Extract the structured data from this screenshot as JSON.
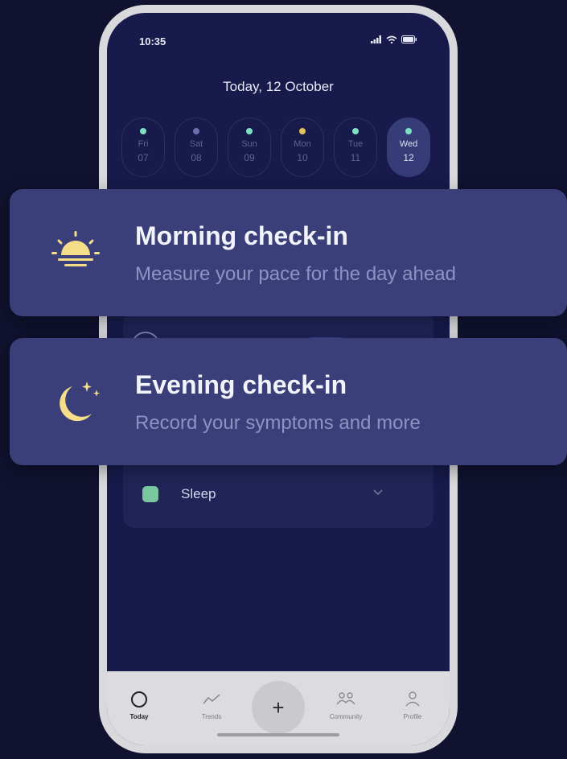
{
  "status_bar": {
    "time": "10:35"
  },
  "header": {
    "date_title": "Today, 12 October"
  },
  "days": [
    {
      "name": "Fri",
      "num": "07",
      "dot_color": "#7ee0c0",
      "active": false
    },
    {
      "name": "Sat",
      "num": "08",
      "dot_color": "#6b6fae",
      "active": false
    },
    {
      "name": "Sun",
      "num": "09",
      "dot_color": "#7ee0c0",
      "active": false
    },
    {
      "name": "Mon",
      "num": "10",
      "dot_color": "#e6c15a",
      "active": false
    },
    {
      "name": "Tue",
      "num": "11",
      "dot_color": "#7ee0c0",
      "active": false
    },
    {
      "name": "Wed",
      "num": "12",
      "dot_color": "#7ee0c0",
      "active": true
    }
  ],
  "list": {
    "sleep_label": "Sleep",
    "sleep_color": "#79c69f"
  },
  "popups": {
    "morning": {
      "title": "Morning check-in",
      "subtitle": "Measure your pace for the day ahead",
      "icon": "sunrise-icon"
    },
    "evening": {
      "title": "Evening check-in",
      "subtitle": "Record your symptoms and more",
      "icon": "moon-stars-icon"
    }
  },
  "tabbar": {
    "items": [
      {
        "label": "Today",
        "icon": "circle-icon"
      },
      {
        "label": "Trends",
        "icon": "trend-icon"
      },
      {
        "label": "Community",
        "icon": "community-icon"
      },
      {
        "label": "Profile",
        "icon": "profile-icon"
      }
    ],
    "add_label": "+"
  },
  "colors": {
    "background": "#10122f",
    "screen": "#171a4a",
    "popup": "#3a3f7a",
    "icon_yellow": "#f6dd8a"
  }
}
